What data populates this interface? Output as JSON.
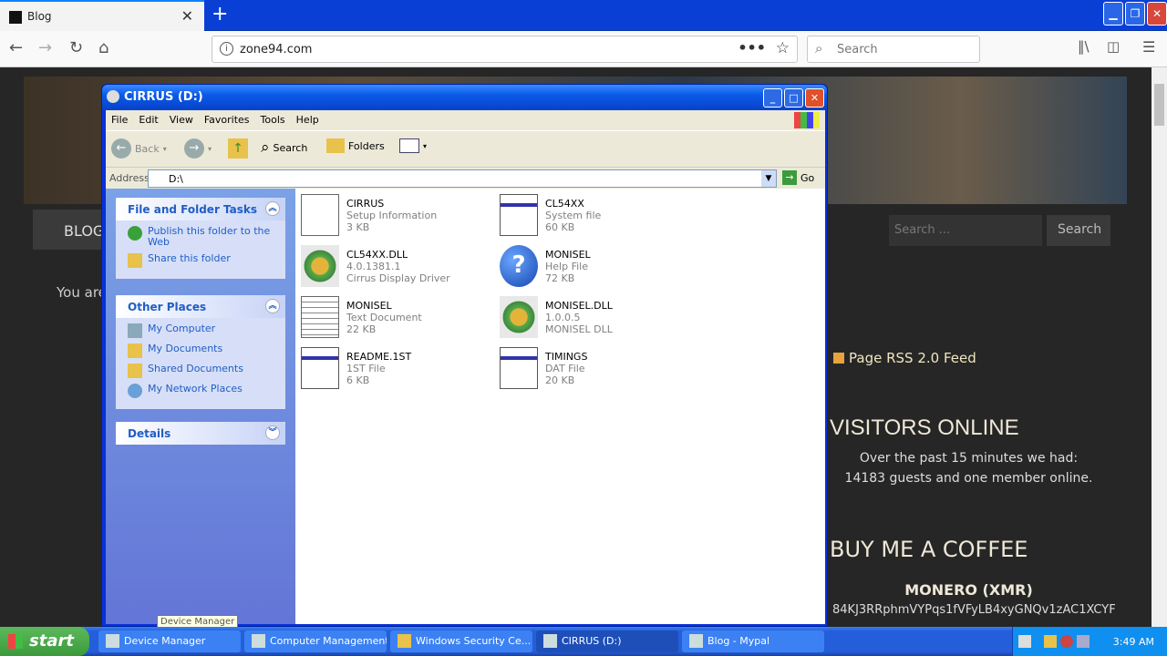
{
  "browser": {
    "tab_title": "Blog",
    "url": "zone94.com",
    "search_placeholder": "Search"
  },
  "website": {
    "nav_blog": "BLOG",
    "search_placeholder": "Search ...",
    "search_button": "Search",
    "you_are": "You are",
    "rss": "Page RSS 2.0 Feed",
    "visitors_heading": "VISITORS ONLINE",
    "visitors_line1": "Over the past 15 minutes we had:",
    "visitors_line2": "14183 guests and one member online.",
    "coffee_heading": "BUY ME A COFFEE",
    "monero": "MONERO (XMR)",
    "address": "84KJ3RRphmVYPqs1fVFyLB4xyGNQv1zAC1XCYF"
  },
  "explorer": {
    "title": "CIRRUS (D:)",
    "menu": [
      "File",
      "Edit",
      "View",
      "Favorites",
      "Tools",
      "Help"
    ],
    "toolbar": {
      "back": "Back",
      "search": "Search",
      "folders": "Folders"
    },
    "address_label": "Address",
    "address_value": "D:\\",
    "go": "Go",
    "tasks": {
      "title": "File and Folder Tasks",
      "items": [
        "Publish this folder to the Web",
        "Share this folder"
      ]
    },
    "other": {
      "title": "Other Places",
      "items": [
        "My Computer",
        "My Documents",
        "Shared Documents",
        "My Network Places"
      ]
    },
    "details": {
      "title": "Details"
    },
    "files": [
      {
        "name": "CIRRUS",
        "d1": "Setup Information",
        "d2": "3 KB",
        "icon": "setup-info-icon"
      },
      {
        "name": "CL54XX",
        "d1": "System file",
        "d2": "60 KB",
        "icon": "system-file-icon"
      },
      {
        "name": "CL54XX.DLL",
        "d1": "4.0.1381.1",
        "d2": "Cirrus Display Driver",
        "icon": "dll-icon"
      },
      {
        "name": "MONISEL",
        "d1": "Help File",
        "d2": "72 KB",
        "icon": "help-file-icon"
      },
      {
        "name": "MONISEL",
        "d1": "Text Document",
        "d2": "22 KB",
        "icon": "text-document-icon"
      },
      {
        "name": "MONISEL.DLL",
        "d1": "1.0.0.5",
        "d2": "MONISEL DLL",
        "icon": "dll-icon"
      },
      {
        "name": "README.1ST",
        "d1": "1ST File",
        "d2": "6 KB",
        "icon": "generic-file-icon"
      },
      {
        "name": "TIMINGS",
        "d1": "DAT File",
        "d2": "20 KB",
        "icon": "generic-file-icon"
      }
    ]
  },
  "tooltip": "Device Manager",
  "taskbar": {
    "start": "start",
    "tasks": [
      "Device Manager",
      "Computer Management",
      "Windows Security Ce...",
      "CIRRUS (D:)",
      "Blog - Mypal"
    ],
    "clock": "3:49 AM"
  }
}
